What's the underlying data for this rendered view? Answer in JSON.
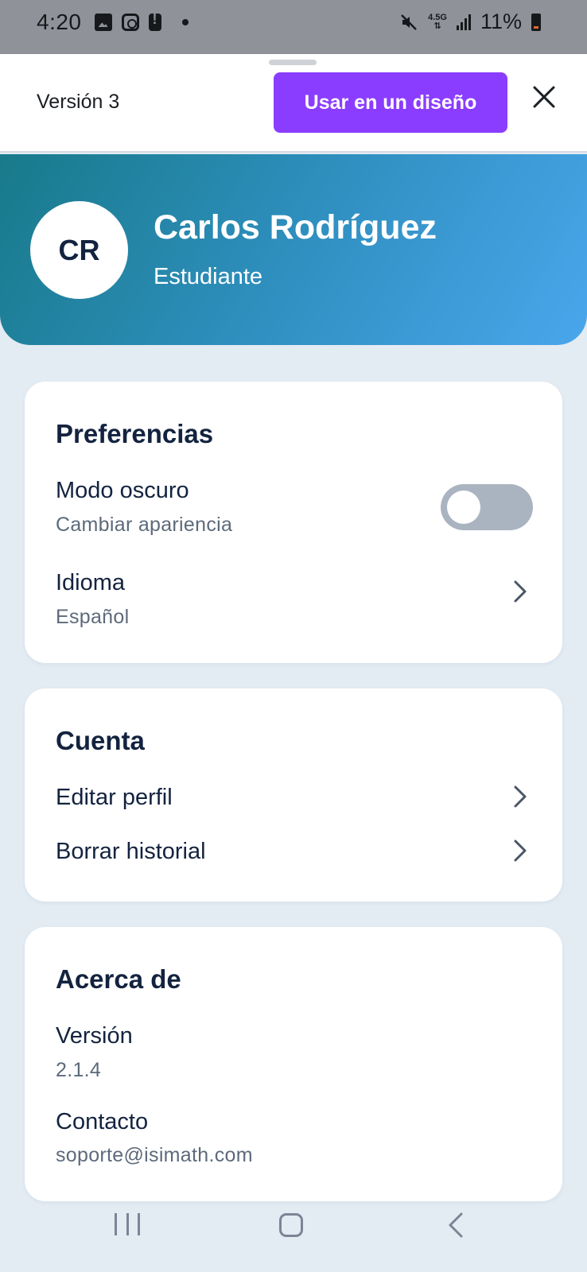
{
  "status_bar": {
    "time": "4:20",
    "network": "4.5G",
    "battery": "11%",
    "icons": [
      "gallery-icon",
      "instagram-icon",
      "alert-icon",
      "notification-dot-icon",
      "mute-icon",
      "signal-icon",
      "battery-icon"
    ]
  },
  "sheet": {
    "version_label": "Versión 3",
    "use_button": "Usar en un diseño",
    "close_icon": "close-icon"
  },
  "profile": {
    "initials": "CR",
    "name": "Carlos Rodríguez",
    "role": "Estudiante"
  },
  "preferences": {
    "title": "Preferencias",
    "dark_mode": {
      "label": "Modo oscuro",
      "description": "Cambiar apariencia",
      "enabled": false
    },
    "language": {
      "label": "Idioma",
      "value": "Español"
    }
  },
  "account": {
    "title": "Cuenta",
    "items": [
      {
        "label": "Editar perfil"
      },
      {
        "label": "Borrar historial"
      }
    ]
  },
  "about": {
    "title": "Acerca de",
    "version_label": "Versión",
    "version_value": "2.1.4",
    "contact_label": "Contacto",
    "contact_value": "soporte@isimath.com"
  },
  "colors": {
    "accent_button": "#8b3dff",
    "header_gradient_start": "#187a8a",
    "header_gradient_end": "#4aa6ec",
    "page_background": "#e3ebf3",
    "toggle_off": "#aab4c0"
  }
}
